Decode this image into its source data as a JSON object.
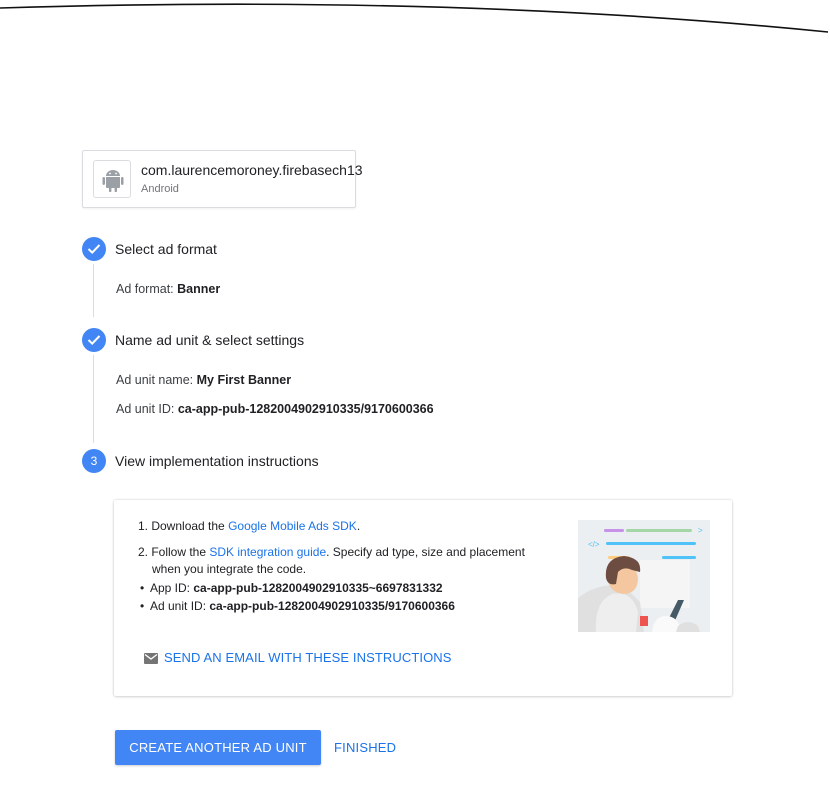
{
  "app": {
    "package_name": "com.laurencemoroney.firebasech13",
    "platform": "Android",
    "icon": "android-icon"
  },
  "steps": [
    {
      "indicator": "check-icon",
      "title": "Select ad format",
      "details": [
        {
          "label": "Ad format: ",
          "value": "Banner"
        }
      ]
    },
    {
      "indicator": "check-icon",
      "title": "Name ad unit & select settings",
      "details": [
        {
          "label": "Ad unit name: ",
          "value": "My First Banner"
        },
        {
          "label": "Ad unit ID: ",
          "value": "ca-app-pub-1282004902910335/9170600366"
        }
      ]
    },
    {
      "number": "3",
      "title": "View implementation instructions"
    }
  ],
  "instructions": {
    "item1_prefix": "1. Download the ",
    "item1_link": "Google Mobile Ads SDK",
    "item1_suffix": ".",
    "item2_prefix": "2. Follow the ",
    "item2_link": "SDK integration guide",
    "item2_suffix": ". Specify ad type, size and placement",
    "item2_line2": "when you integrate the code.",
    "app_id_label": "App ID: ",
    "app_id_value": "ca-app-pub-1282004902910335~6697831332",
    "ad_unit_id_label": "Ad unit ID: ",
    "ad_unit_id_value": "ca-app-pub-1282004902910335/9170600366",
    "email_label": "SEND AN EMAIL WITH THESE INSTRUCTIONS",
    "illustration_code_mark": "</>"
  },
  "actions": {
    "create_another": "CREATE ANOTHER AD UNIT",
    "finished": "FINISHED"
  },
  "colors": {
    "accent": "#4285f4",
    "link": "#1a73e8",
    "border": "#dadce0"
  }
}
